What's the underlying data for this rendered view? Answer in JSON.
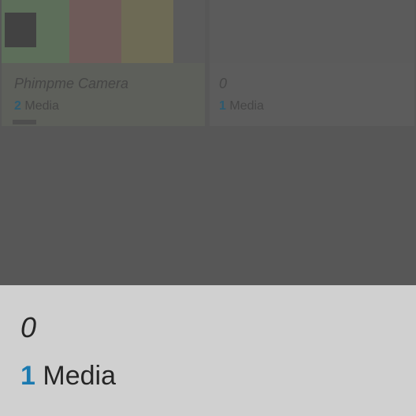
{
  "grid": {
    "albums": [
      {
        "name": "Phimpme Camera",
        "count": "2",
        "unit": "Media"
      },
      {
        "name": "0",
        "count": "1",
        "unit": "Media"
      }
    ]
  },
  "selected": {
    "name": "0",
    "count": "1",
    "unit": "Media"
  },
  "colors": {
    "accent": "#1b7ab0",
    "panel_bg": "#d0d0d0",
    "overlay_bg": "#575757"
  }
}
